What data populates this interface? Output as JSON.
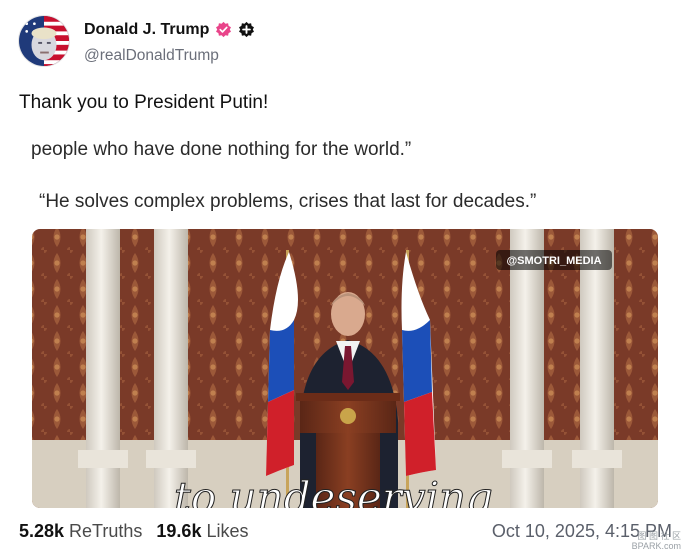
{
  "author": {
    "display_name": "Donald J. Trump",
    "handle": "@realDonaldTrump",
    "verified_icon": "verified-badge-icon",
    "extra_icon": "plus-badge-icon",
    "verified_color": "#e9448a"
  },
  "post": {
    "text": "Thank you to President Putin!"
  },
  "media": {
    "quote_line_1": "people who have done nothing for the world.”",
    "quote_line_2": "“He solves complex problems, crises that last for decades.”",
    "video_tag": "@SMOTRI_MEDIA",
    "caption": "to undeserving"
  },
  "stats": {
    "retruths_count": "5.28k",
    "retruths_label": "ReTruths",
    "likes_count": "19.6k",
    "likes_label": "Likes"
  },
  "timestamp": "Oct 10, 2025, 4:15 PM",
  "watermark": {
    "line1": "图 图 社 区",
    "line2": "BPARK.com"
  }
}
